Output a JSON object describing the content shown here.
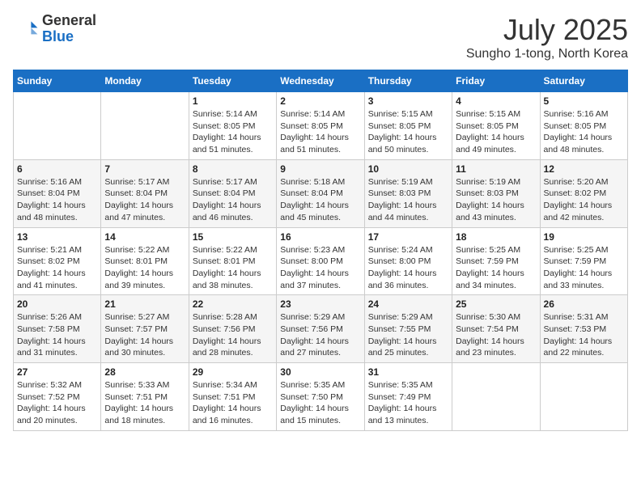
{
  "header": {
    "logo_line1": "General",
    "logo_line2": "Blue",
    "month": "July 2025",
    "location": "Sungho 1-tong, North Korea"
  },
  "weekdays": [
    "Sunday",
    "Monday",
    "Tuesday",
    "Wednesday",
    "Thursday",
    "Friday",
    "Saturday"
  ],
  "weeks": [
    [
      {
        "day": "",
        "info": ""
      },
      {
        "day": "",
        "info": ""
      },
      {
        "day": "1",
        "info": "Sunrise: 5:14 AM\nSunset: 8:05 PM\nDaylight: 14 hours and 51 minutes."
      },
      {
        "day": "2",
        "info": "Sunrise: 5:14 AM\nSunset: 8:05 PM\nDaylight: 14 hours and 51 minutes."
      },
      {
        "day": "3",
        "info": "Sunrise: 5:15 AM\nSunset: 8:05 PM\nDaylight: 14 hours and 50 minutes."
      },
      {
        "day": "4",
        "info": "Sunrise: 5:15 AM\nSunset: 8:05 PM\nDaylight: 14 hours and 49 minutes."
      },
      {
        "day": "5",
        "info": "Sunrise: 5:16 AM\nSunset: 8:05 PM\nDaylight: 14 hours and 48 minutes."
      }
    ],
    [
      {
        "day": "6",
        "info": "Sunrise: 5:16 AM\nSunset: 8:04 PM\nDaylight: 14 hours and 48 minutes."
      },
      {
        "day": "7",
        "info": "Sunrise: 5:17 AM\nSunset: 8:04 PM\nDaylight: 14 hours and 47 minutes."
      },
      {
        "day": "8",
        "info": "Sunrise: 5:17 AM\nSunset: 8:04 PM\nDaylight: 14 hours and 46 minutes."
      },
      {
        "day": "9",
        "info": "Sunrise: 5:18 AM\nSunset: 8:04 PM\nDaylight: 14 hours and 45 minutes."
      },
      {
        "day": "10",
        "info": "Sunrise: 5:19 AM\nSunset: 8:03 PM\nDaylight: 14 hours and 44 minutes."
      },
      {
        "day": "11",
        "info": "Sunrise: 5:19 AM\nSunset: 8:03 PM\nDaylight: 14 hours and 43 minutes."
      },
      {
        "day": "12",
        "info": "Sunrise: 5:20 AM\nSunset: 8:02 PM\nDaylight: 14 hours and 42 minutes."
      }
    ],
    [
      {
        "day": "13",
        "info": "Sunrise: 5:21 AM\nSunset: 8:02 PM\nDaylight: 14 hours and 41 minutes."
      },
      {
        "day": "14",
        "info": "Sunrise: 5:22 AM\nSunset: 8:01 PM\nDaylight: 14 hours and 39 minutes."
      },
      {
        "day": "15",
        "info": "Sunrise: 5:22 AM\nSunset: 8:01 PM\nDaylight: 14 hours and 38 minutes."
      },
      {
        "day": "16",
        "info": "Sunrise: 5:23 AM\nSunset: 8:00 PM\nDaylight: 14 hours and 37 minutes."
      },
      {
        "day": "17",
        "info": "Sunrise: 5:24 AM\nSunset: 8:00 PM\nDaylight: 14 hours and 36 minutes."
      },
      {
        "day": "18",
        "info": "Sunrise: 5:25 AM\nSunset: 7:59 PM\nDaylight: 14 hours and 34 minutes."
      },
      {
        "day": "19",
        "info": "Sunrise: 5:25 AM\nSunset: 7:59 PM\nDaylight: 14 hours and 33 minutes."
      }
    ],
    [
      {
        "day": "20",
        "info": "Sunrise: 5:26 AM\nSunset: 7:58 PM\nDaylight: 14 hours and 31 minutes."
      },
      {
        "day": "21",
        "info": "Sunrise: 5:27 AM\nSunset: 7:57 PM\nDaylight: 14 hours and 30 minutes."
      },
      {
        "day": "22",
        "info": "Sunrise: 5:28 AM\nSunset: 7:56 PM\nDaylight: 14 hours and 28 minutes."
      },
      {
        "day": "23",
        "info": "Sunrise: 5:29 AM\nSunset: 7:56 PM\nDaylight: 14 hours and 27 minutes."
      },
      {
        "day": "24",
        "info": "Sunrise: 5:29 AM\nSunset: 7:55 PM\nDaylight: 14 hours and 25 minutes."
      },
      {
        "day": "25",
        "info": "Sunrise: 5:30 AM\nSunset: 7:54 PM\nDaylight: 14 hours and 23 minutes."
      },
      {
        "day": "26",
        "info": "Sunrise: 5:31 AM\nSunset: 7:53 PM\nDaylight: 14 hours and 22 minutes."
      }
    ],
    [
      {
        "day": "27",
        "info": "Sunrise: 5:32 AM\nSunset: 7:52 PM\nDaylight: 14 hours and 20 minutes."
      },
      {
        "day": "28",
        "info": "Sunrise: 5:33 AM\nSunset: 7:51 PM\nDaylight: 14 hours and 18 minutes."
      },
      {
        "day": "29",
        "info": "Sunrise: 5:34 AM\nSunset: 7:51 PM\nDaylight: 14 hours and 16 minutes."
      },
      {
        "day": "30",
        "info": "Sunrise: 5:35 AM\nSunset: 7:50 PM\nDaylight: 14 hours and 15 minutes."
      },
      {
        "day": "31",
        "info": "Sunrise: 5:35 AM\nSunset: 7:49 PM\nDaylight: 14 hours and 13 minutes."
      },
      {
        "day": "",
        "info": ""
      },
      {
        "day": "",
        "info": ""
      }
    ]
  ]
}
